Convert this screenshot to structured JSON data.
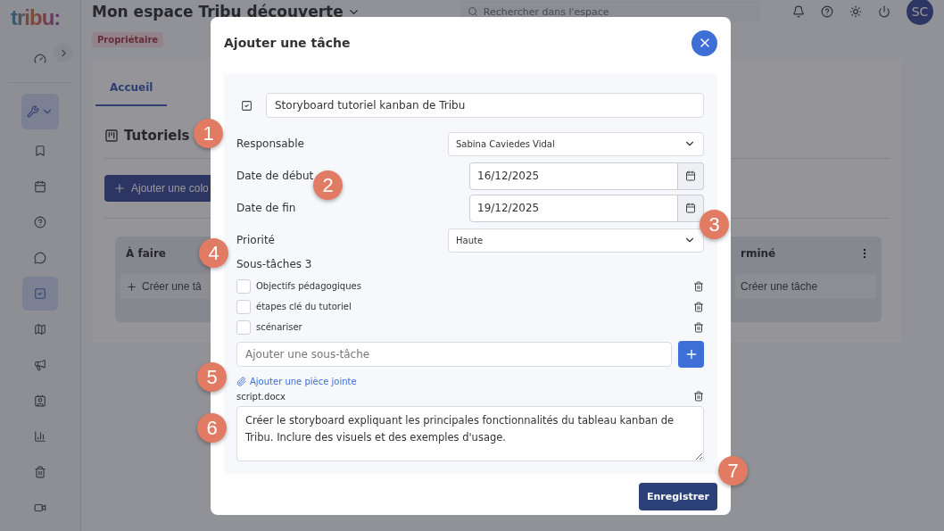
{
  "sidebar": {
    "logo": "tribu:",
    "items": [
      {
        "kind": "link",
        "selected": false
      },
      {
        "kind": "group",
        "selected": true
      },
      {
        "kind": "link",
        "selected": false
      },
      {
        "kind": "link",
        "selected": false
      },
      {
        "kind": "link",
        "selected": false
      },
      {
        "kind": "link",
        "selected": false
      },
      {
        "kind": "link",
        "selected": true
      },
      {
        "kind": "link",
        "selected": false
      },
      {
        "kind": "link",
        "selected": false
      },
      {
        "kind": "link",
        "selected": false
      },
      {
        "kind": "link",
        "selected": false
      },
      {
        "kind": "link",
        "selected": false
      },
      {
        "kind": "link",
        "selected": false
      }
    ]
  },
  "header": {
    "title": "Mon espace Tribu découverte",
    "badge": "Propriétaire",
    "search": {
      "placeholder": "Rechercher dans l'espace"
    },
    "avatar": "SC"
  },
  "tabs": [
    {
      "label": "Accueil",
      "selected": true
    }
  ],
  "board": {
    "title": "Tutoriels",
    "add_column_button": "Ajouter une colo",
    "columns": [
      {
        "title": "À faire",
        "create_button": "Créer une tâ"
      },
      {
        "title": "rminé",
        "create_button": "Créer une tâche",
        "menu": true
      }
    ]
  },
  "modal": {
    "title": "Ajouter une tâche",
    "task_title": "Storyboard tutoriel kanban de Tribu",
    "fields": [
      {
        "kind": "select",
        "label": "Responsable",
        "value": "Sabina Caviedes Vidal"
      },
      {
        "kind": "date",
        "label": "Date de début",
        "value": "16/12/2025"
      },
      {
        "kind": "date",
        "label": "Date de fin",
        "value": "19/12/2025"
      },
      {
        "kind": "select",
        "label": "Priorité",
        "value": "Haute"
      }
    ],
    "subtasks_label": "Sous-tâches 3",
    "subtasks": [
      {
        "label": "Objectifs pédagogiques",
        "checked": false
      },
      {
        "label": "étapes clé du tutoriel",
        "checked": false
      },
      {
        "label": "scénariser",
        "checked": false
      }
    ],
    "new_subtask": {
      "placeholder": "Ajouter une sous-tâche"
    },
    "attach_link": "Ajouter une pièce jointe",
    "attachments": [
      "script.docx"
    ],
    "description": "Créer le storyboard expliquant les principales fonctionnalités du tableau kanban de Tribu. Inclure des visuels et des exemples d'usage.",
    "save_button": "Enregistrer"
  },
  "callouts": [
    {
      "label": "1"
    },
    {
      "label": "2"
    },
    {
      "label": "3"
    },
    {
      "label": "4"
    },
    {
      "label": "5"
    },
    {
      "label": "6"
    },
    {
      "label": "7"
    }
  ]
}
